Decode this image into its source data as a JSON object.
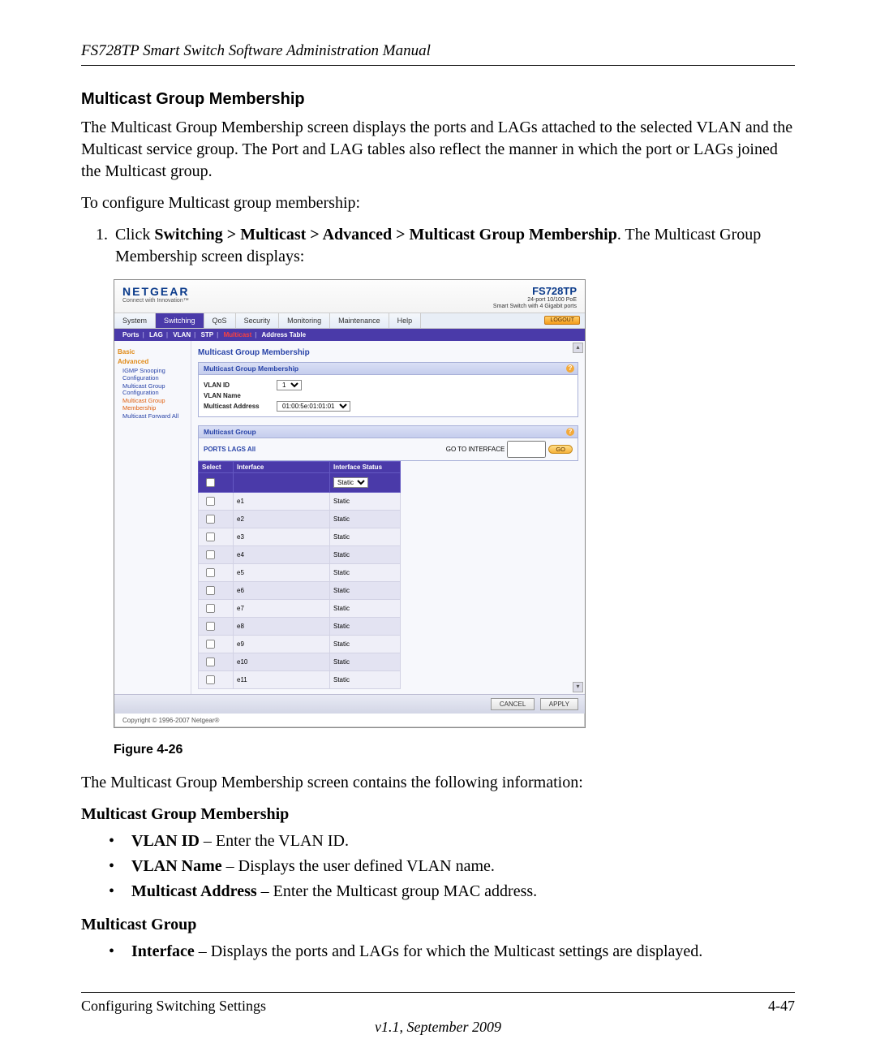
{
  "doc": {
    "running_head": "FS728TP Smart Switch Software Administration Manual",
    "section_title": "Multicast Group Membership",
    "intro": "The Multicast Group Membership screen displays the ports and LAGs attached to the selected VLAN and the Multicast service group. The Port and LAG tables also reflect the manner in which the port or LAGs joined the Multicast group.",
    "intro2": "To configure Multicast group membership:",
    "step1a": "Click ",
    "step1b": "Switching > Multicast > Advanced > Multicast Group Membership",
    "step1c": ". The Multicast Group Membership screen displays:",
    "figure_caption": "Figure 4-26",
    "after_fig": "The Multicast Group Membership screen contains the following information:",
    "sub_h1": "Multicast Group Membership",
    "b1a": "VLAN ID",
    "b1b": " – Enter the VLAN ID.",
    "b2a": "VLAN Name",
    "b2b": " – Displays the user defined VLAN name.",
    "b3a": "Multicast Address",
    "b3b": " – Enter the Multicast group MAC address.",
    "sub_h2": "Multicast Group",
    "b4a": "Interface",
    "b4b": " – Displays the ports and LAGs for which the Multicast settings are displayed.",
    "footer_left": "Configuring Switching Settings",
    "footer_right": "4-47",
    "footer_center": "v1.1, September 2009"
  },
  "ui": {
    "brand": "NETGEAR",
    "tagline": "Connect with Innovation™",
    "model": "FS728TP",
    "model_sub1": "24-port 10/100 PoE",
    "model_sub2": "Smart Switch with 4 Gigabit ports",
    "tabs": [
      "System",
      "Switching",
      "QoS",
      "Security",
      "Monitoring",
      "Maintenance",
      "Help"
    ],
    "active_tab": "Switching",
    "logout": "LOGOUT",
    "subnav": [
      "Ports",
      "LAG",
      "VLAN",
      "STP",
      "Multicast",
      "Address Table"
    ],
    "subnav_active": "Multicast",
    "sidebar": {
      "cats": [
        {
          "label": "Basic",
          "items": []
        },
        {
          "label": "Advanced",
          "items": [
            {
              "label": "IGMP Snooping Configuration",
              "sel": false
            },
            {
              "label": "Multicast Group Configuration",
              "sel": false
            },
            {
              "label": "Multicast Group Membership",
              "sel": true
            },
            {
              "label": "Multicast Forward All",
              "sel": false
            }
          ]
        }
      ]
    },
    "content_h": "Multicast Group Membership",
    "panel1_h": "Multicast Group Membership",
    "form": {
      "vlan_id_label": "VLAN ID",
      "vlan_id_value": "1",
      "vlan_name_label": "VLAN Name",
      "vlan_name_value": "",
      "mcast_addr_label": "Multicast Address",
      "mcast_addr_value": "01:00:5e:01:01:01"
    },
    "panel2_h": "Multicast Group",
    "portslags": "PORTS LAGS All",
    "goto_label": "GO TO INTERFACE",
    "go": "GO",
    "cols": {
      "select": "Select",
      "interface": "Interface",
      "status": "Interface Status"
    },
    "status_placeholder": "Static",
    "rows": [
      {
        "if": "e1",
        "st": "Static"
      },
      {
        "if": "e2",
        "st": "Static"
      },
      {
        "if": "e3",
        "st": "Static"
      },
      {
        "if": "e4",
        "st": "Static"
      },
      {
        "if": "e5",
        "st": "Static"
      },
      {
        "if": "e6",
        "st": "Static"
      },
      {
        "if": "e7",
        "st": "Static"
      },
      {
        "if": "e8",
        "st": "Static"
      },
      {
        "if": "e9",
        "st": "Static"
      },
      {
        "if": "e10",
        "st": "Static"
      },
      {
        "if": "e11",
        "st": "Static"
      }
    ],
    "cancel": "CANCEL",
    "apply": "APPLY",
    "copyright": "Copyright © 1996-2007 Netgear®"
  }
}
